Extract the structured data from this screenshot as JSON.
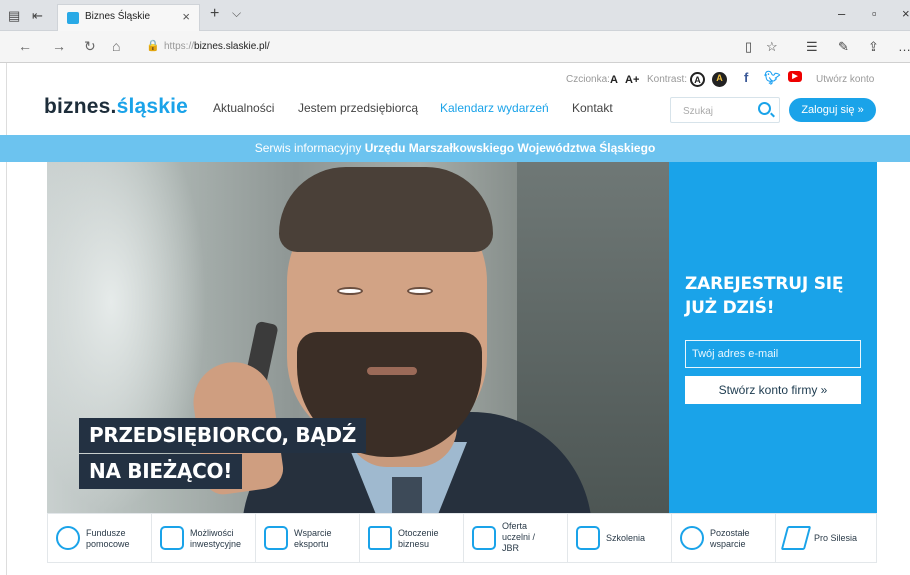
{
  "browser": {
    "tab_title": "Biznes Śląskie",
    "url_prefix": "https://",
    "url_host": "biznes.slaskie.pl/"
  },
  "site": {
    "logo_main": "biznes.",
    "logo_accent": "śląskie",
    "font_size_label": "Czcionka:",
    "font_small": "A",
    "font_big": "A+",
    "contrast_label": "Kontrast:",
    "contrast_a": "A",
    "contrast_b": "A",
    "create_account": "Utwórz konto",
    "menu": [
      {
        "label": "Aktualności"
      },
      {
        "label": "Jestem przedsiębiorcą"
      },
      {
        "label": "Kalendarz wydarzeń"
      },
      {
        "label": "Kontakt"
      }
    ],
    "search_placeholder": "Szukaj",
    "login_label": "Zaloguj się »",
    "banner_prefix": "Serwis informacyjny",
    "banner_bold": "Urzędu Marszałkowskiego Województwa Śląskiego"
  },
  "hero": {
    "line1": "PRZEDSIĘBIORCO, BĄDŹ",
    "line2": "NA BIEŻĄCO!"
  },
  "register": {
    "title1": "ZAREJESTRUJ SIĘ",
    "title2": "JUŻ DZIŚ!",
    "email_placeholder": "Twój adres e-mail",
    "create_button": "Stwórz konto firmy »"
  },
  "categories": [
    {
      "line1": "Fundusze",
      "line2": "pomocowe",
      "line3": ""
    },
    {
      "line1": "Możliwości",
      "line2": "inwestycyjne",
      "line3": ""
    },
    {
      "line1": "Wsparcie",
      "line2": "eksportu",
      "line3": ""
    },
    {
      "line1": "Otoczenie",
      "line2": "biznesu",
      "line3": ""
    },
    {
      "line1": "Oferta",
      "line2": "uczelni /",
      "line3": "JBR"
    },
    {
      "line1": "Szkolenia",
      "line2": "",
      "line3": ""
    },
    {
      "line1": "Pozostałe",
      "line2": "wsparcie",
      "line3": ""
    },
    {
      "line1": "Pro Silesia",
      "line2": "",
      "line3": ""
    }
  ],
  "colors": {
    "accent": "#1aa3e9",
    "banner": "#6cc3ef",
    "dark": "#233142"
  }
}
